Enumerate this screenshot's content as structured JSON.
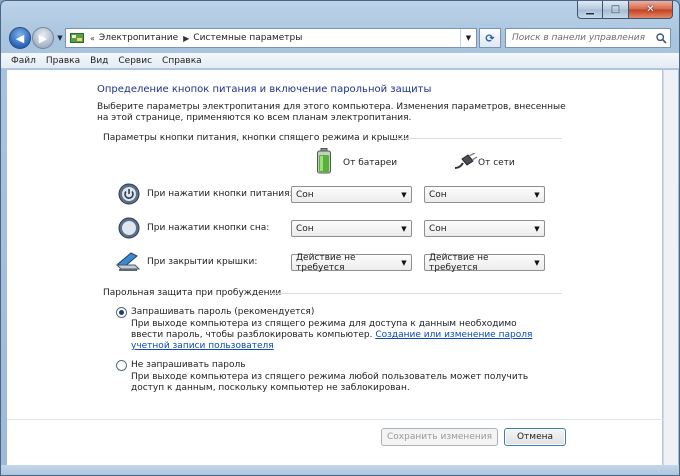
{
  "window": {
    "breadcrumbs": [
      "Электропитание",
      "Системные параметры"
    ],
    "search_placeholder": "Поиск в панели управления"
  },
  "menu": [
    "Файл",
    "Правка",
    "Вид",
    "Сервис",
    "Справка"
  ],
  "page": {
    "title": "Определение кнопок питания и включение парольной защиты",
    "description": "Выберите параметры электропитания для этого компьютера. Изменения параметров, внесенные на этой странице, применяются ко всем планам электропитания."
  },
  "buttons_section": {
    "header": "Параметры кнопки питания, кнопки спящего режима и крышки",
    "col_battery": "От батареи",
    "col_ac": "От сети",
    "rows": [
      {
        "label": "При нажатии кнопки питания:",
        "battery": "Сон",
        "ac": "Сон"
      },
      {
        "label": "При нажатии кнопки сна:",
        "battery": "Сон",
        "ac": "Сон"
      },
      {
        "label": "При закрытии крышки:",
        "battery": "Действие не требуется",
        "ac": "Действие не требуется"
      }
    ]
  },
  "password_section": {
    "header": "Парольная защита при пробуждении",
    "option1_label": "Запрашивать пароль (рекомендуется)",
    "option1_desc": "При выходе компьютера из спящего режима для доступа к данным необходимо ввести пароль, чтобы разблокировать компьютер.",
    "option1_link": "Создание или изменение пароля учетной записи пользователя",
    "option2_label": "Не запрашивать пароль",
    "option2_desc": "При выходе компьютера из спящего режима любой пользователь может получить доступ к данным, поскольку компьютер не заблокирован.",
    "selected": 1
  },
  "footer": {
    "save_label": "Сохранить изменения",
    "cancel_label": "Отмена"
  }
}
